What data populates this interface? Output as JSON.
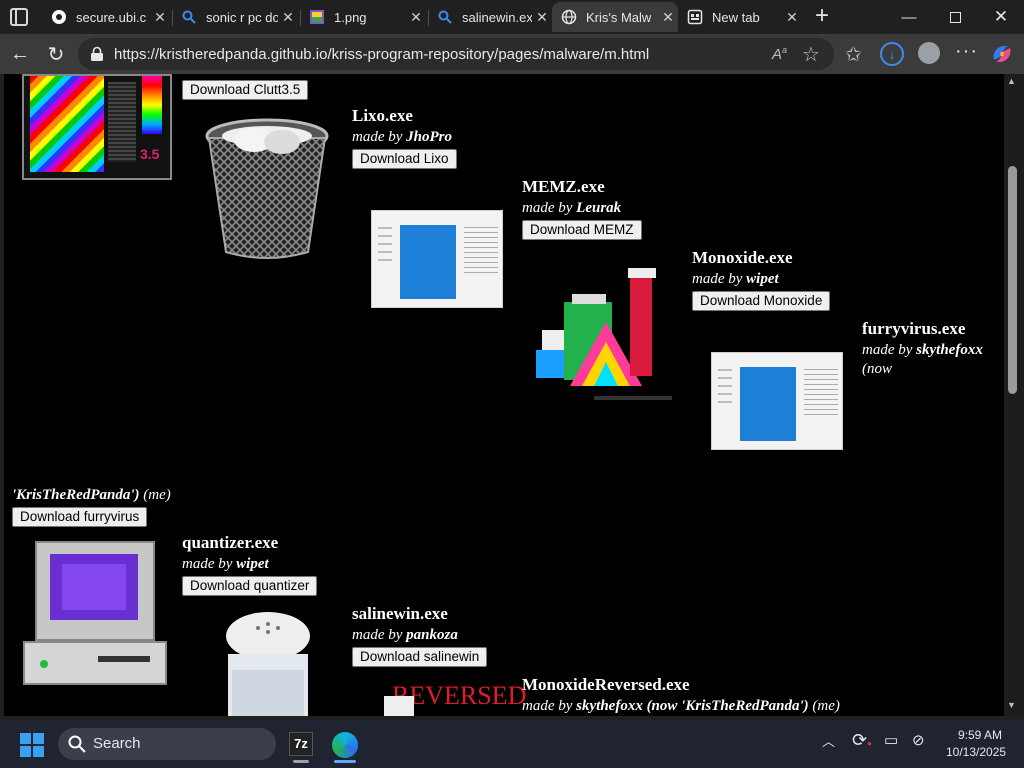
{
  "tabs": [
    {
      "label": "secure.ubi.c",
      "active": false
    },
    {
      "label": "sonic r pc do",
      "active": false
    },
    {
      "label": "1.png",
      "active": false
    },
    {
      "label": "salinewin.ex",
      "active": false
    },
    {
      "label": "Kris's Malw",
      "active": true
    },
    {
      "label": "New tab",
      "active": false
    }
  ],
  "address": {
    "url": "https://kristheredpanda.github.io/kriss-program-repository/pages/malware/m.html"
  },
  "page": {
    "clutt": {
      "button": "Download Clutt3.5",
      "badge": "3.5"
    },
    "lixo": {
      "name": "Lixo.exe",
      "made": "made by",
      "author": "JhoPro",
      "button": "Download Lixo"
    },
    "memz": {
      "name": "MEMZ.exe",
      "made": "made by",
      "author": "Leurak",
      "button": "Download MEMZ"
    },
    "monoxide": {
      "name": "Monoxide.exe",
      "made": "made by",
      "author": "wipet",
      "button": "Download Monoxide"
    },
    "furry": {
      "name": "furryvirus.exe",
      "made": "made by",
      "author": "skythefoxx",
      "line2": "(now",
      "cont_author": "'KrisTheRedPanda')",
      "cont_rest": "(me)",
      "button": "Download furryvirus"
    },
    "quantizer": {
      "name": "quantizer.exe",
      "made": "made by",
      "author": "wipet",
      "button": "Download quantizer"
    },
    "saline": {
      "name": "salinewin.exe",
      "made": "made by",
      "author": "pankoza",
      "button": "Download salinewin"
    },
    "monorev": {
      "name": "MonoxideReversed.exe",
      "made": "made by",
      "author": "skythefoxx (now 'KrisTheRedPanda')",
      "rest": "(me)",
      "image_text": "REVERSED"
    }
  },
  "taskbar": {
    "search": "Search",
    "time": "9:59 AM",
    "date": "10/13/2025"
  }
}
